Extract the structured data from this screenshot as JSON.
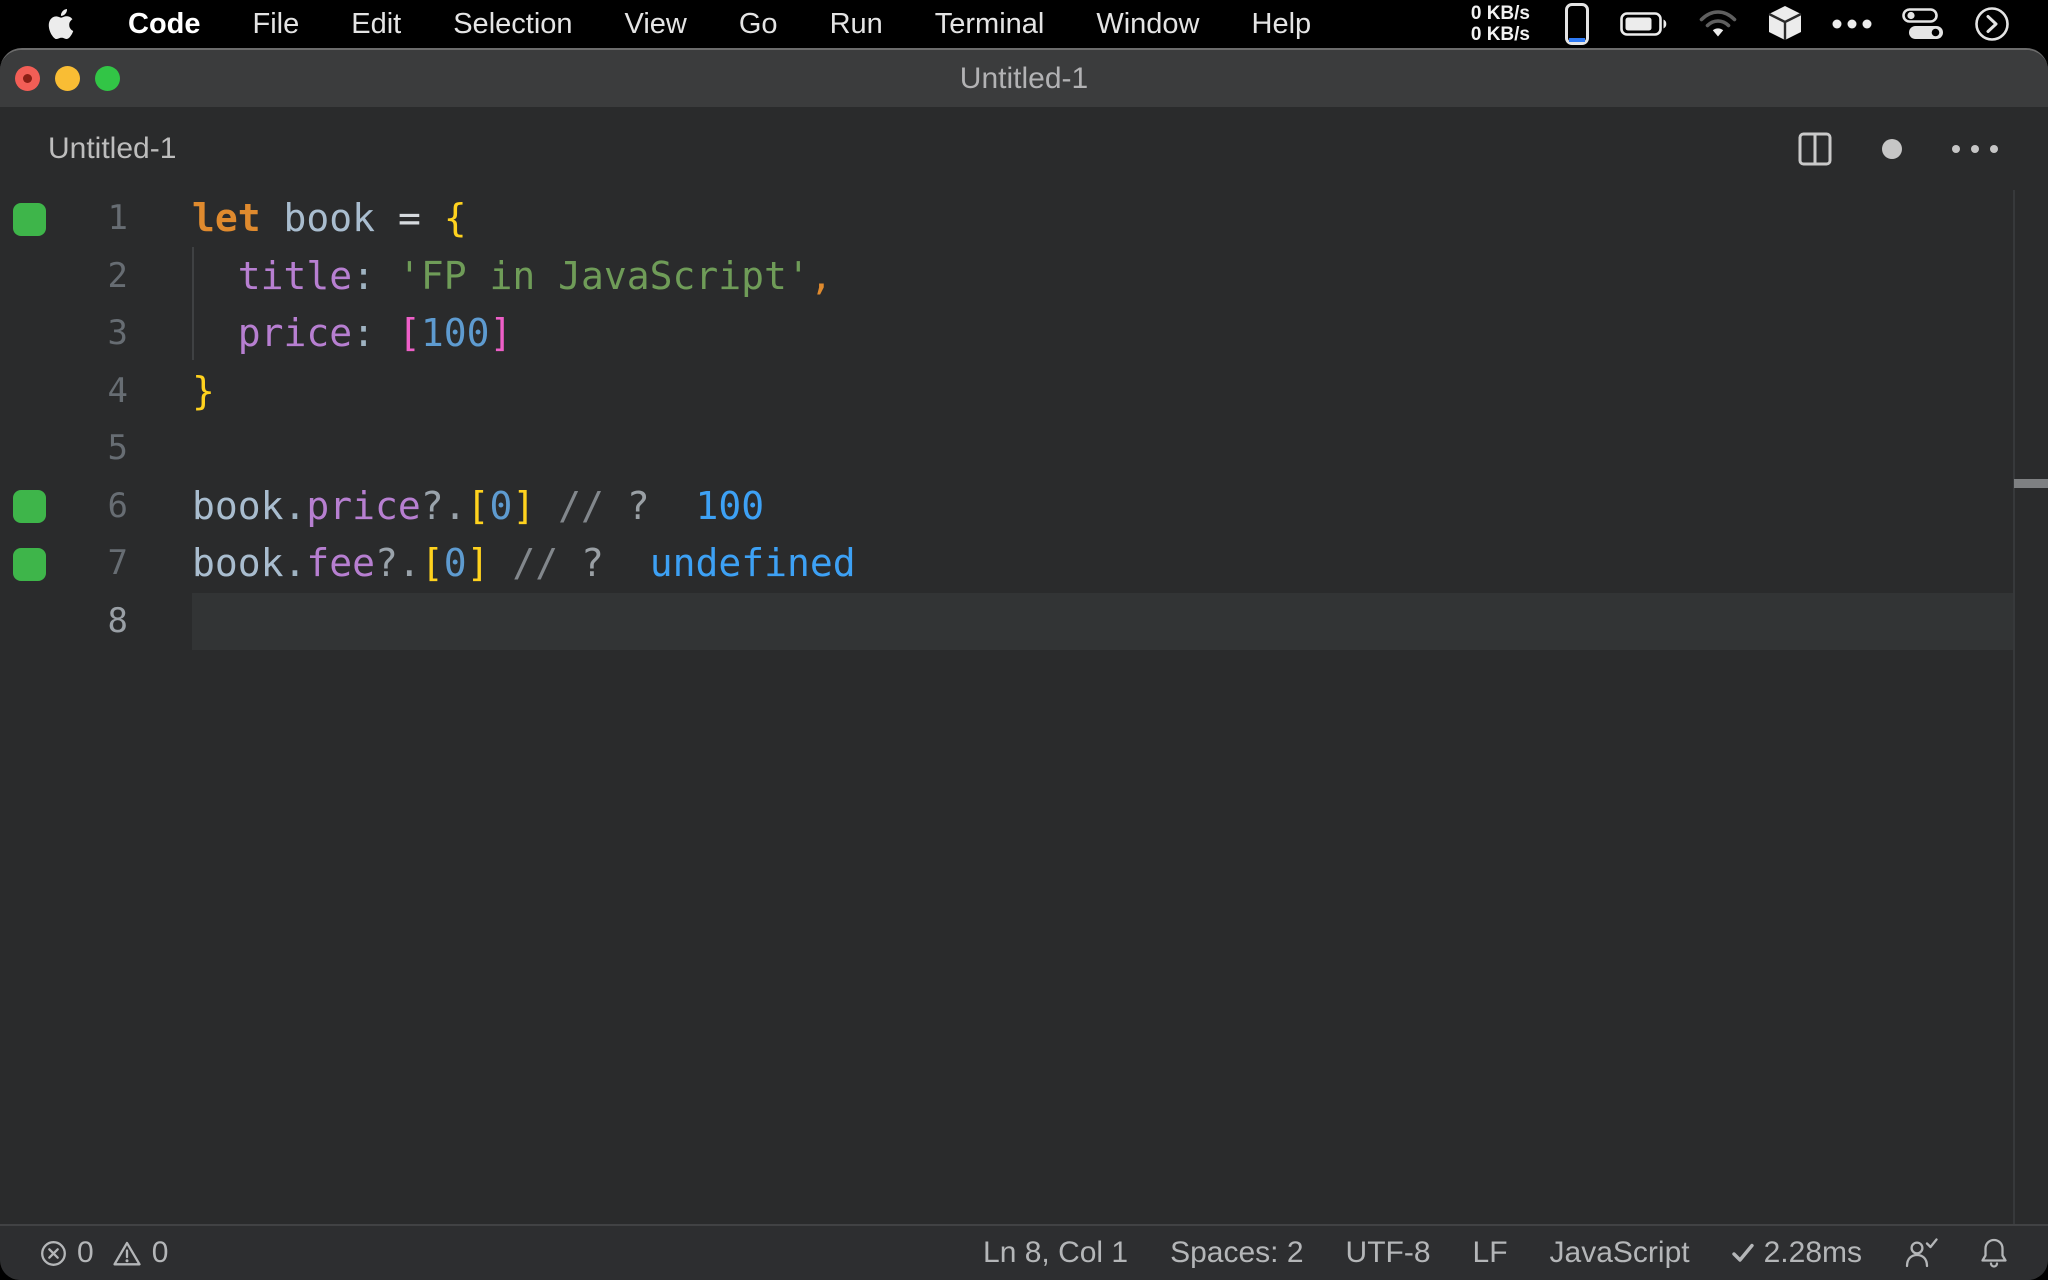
{
  "menubar": {
    "items": [
      "Code",
      "File",
      "Edit",
      "Selection",
      "View",
      "Go",
      "Run",
      "Terminal",
      "Window",
      "Help"
    ],
    "network_up": "0 KB/s",
    "network_down": "0 KB/s",
    "status_icons": [
      "iphone-icon",
      "battery-icon",
      "wifi-icon",
      "cube-icon",
      "ellipsis-icon",
      "control-center-icon",
      "circle-chevron-icon"
    ]
  },
  "window": {
    "title": "Untitled-1",
    "tab_label": "Untitled-1",
    "tab_dirty": true,
    "editor_action_icons": [
      "split-editor-icon",
      "dirty-indicator",
      "more-actions-icon"
    ]
  },
  "editor": {
    "active_line": 8,
    "palette": {
      "keyword": "#df8a2e",
      "identifier": "#a9bdcf",
      "operator": "#d6dade",
      "brace_l1": "#ffd21e",
      "bracket_l2": "#ee5fc8",
      "property": "#b77fd1",
      "punct": "#9fb3c2",
      "string": "#6f9c58",
      "comma": "#df8a2e",
      "number": "#5e9bd0",
      "comment": "#82878c",
      "question": "#9aa0a5",
      "optional_chain": "#9aa3ab",
      "result": "#3da1f5",
      "coverage_green": "#3eb54a"
    },
    "lines": [
      {
        "number": "1",
        "coverage": true,
        "active": false,
        "tokens": [
          [
            "let",
            "keyword"
          ],
          [
            " ",
            "plain"
          ],
          [
            "book",
            "identifier"
          ],
          [
            " ",
            "plain"
          ],
          [
            "=",
            "operator"
          ],
          [
            " ",
            "plain"
          ],
          [
            "{",
            "brace_l1"
          ]
        ]
      },
      {
        "number": "2",
        "coverage": false,
        "active": false,
        "tokens": [
          [
            "  ",
            "plain"
          ],
          [
            "title",
            "property"
          ],
          [
            ":",
            "punct"
          ],
          [
            " ",
            "plain"
          ],
          [
            "'FP in JavaScript'",
            "string"
          ],
          [
            ",",
            "comma"
          ]
        ]
      },
      {
        "number": "3",
        "coverage": false,
        "active": false,
        "tokens": [
          [
            "  ",
            "plain"
          ],
          [
            "price",
            "property"
          ],
          [
            ":",
            "punct"
          ],
          [
            " ",
            "plain"
          ],
          [
            "[",
            "bracket_l2"
          ],
          [
            "100",
            "number"
          ],
          [
            "]",
            "bracket_l2"
          ]
        ]
      },
      {
        "number": "4",
        "coverage": false,
        "active": false,
        "tokens": [
          [
            "}",
            "brace_l1"
          ]
        ]
      },
      {
        "number": "5",
        "coverage": false,
        "active": false,
        "tokens": []
      },
      {
        "number": "6",
        "coverage": true,
        "active": false,
        "tokens": [
          [
            "book",
            "identifier"
          ],
          [
            ".",
            "punct"
          ],
          [
            "price",
            "property"
          ],
          [
            "?.",
            "optional_chain"
          ],
          [
            "[",
            "brace_l1"
          ],
          [
            "0",
            "number"
          ],
          [
            "]",
            "brace_l1"
          ],
          [
            " ",
            "plain"
          ],
          [
            "//",
            "comment"
          ],
          [
            " ",
            "plain"
          ],
          [
            "?",
            "question"
          ],
          [
            "  ",
            "plain"
          ],
          [
            "100",
            "result"
          ]
        ]
      },
      {
        "number": "7",
        "coverage": true,
        "active": false,
        "tokens": [
          [
            "book",
            "identifier"
          ],
          [
            ".",
            "punct"
          ],
          [
            "fee",
            "property"
          ],
          [
            "?.",
            "optional_chain"
          ],
          [
            "[",
            "brace_l1"
          ],
          [
            "0",
            "number"
          ],
          [
            "]",
            "brace_l1"
          ],
          [
            " ",
            "plain"
          ],
          [
            "//",
            "comment"
          ],
          [
            " ",
            "plain"
          ],
          [
            "?",
            "question"
          ],
          [
            "  ",
            "plain"
          ],
          [
            "undefined",
            "result"
          ]
        ]
      },
      {
        "number": "8",
        "coverage": false,
        "active": true,
        "tokens": []
      }
    ]
  },
  "statusbar": {
    "errors": "0",
    "warnings": "0",
    "cursor_position": "Ln 8, Col 1",
    "indentation": "Spaces: 2",
    "encoding": "UTF-8",
    "eol": "LF",
    "language": "JavaScript",
    "quokka_time": "2.28ms"
  },
  "ui_colors": {
    "traffic_red": "#f25e56",
    "traffic_yellow": "#f9bd34",
    "traffic_green": "#32c546",
    "titlebar_bg": "#3b3c3d"
  }
}
